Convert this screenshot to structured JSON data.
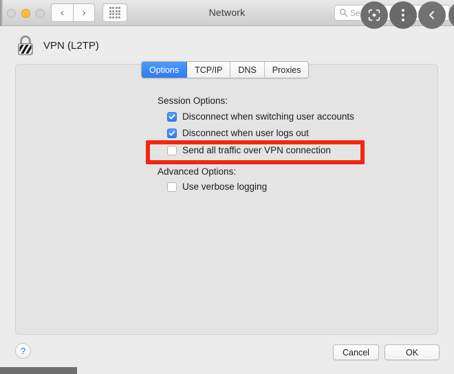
{
  "window": {
    "title": "Network"
  },
  "titlebar": {
    "traffic_lights": [
      {
        "name": "close",
        "state": "disabled"
      },
      {
        "name": "minimize",
        "state": "active"
      },
      {
        "name": "zoom",
        "state": "disabled"
      }
    ],
    "back_icon": "‹",
    "forward_icon": "›",
    "grid_icon": "grid-dots-icon",
    "search": {
      "value": "",
      "placeholder": "Search"
    }
  },
  "overlay_buttons": [
    {
      "name": "lens-icon",
      "label": ""
    },
    {
      "name": "more-vert-icon",
      "label": ""
    },
    {
      "name": "back-chevron-icon",
      "label": "‹"
    },
    {
      "name": "edge-partial",
      "label": ""
    }
  ],
  "sheet": {
    "service_name": "VPN (L2TP)",
    "lock_icon": "lock-icon"
  },
  "tabs": [
    {
      "label": "Options",
      "selected": true
    },
    {
      "label": "TCP/IP",
      "selected": false
    },
    {
      "label": "DNS",
      "selected": false
    },
    {
      "label": "Proxies",
      "selected": false
    }
  ],
  "sections": {
    "session": {
      "label": "Session Options:",
      "options": [
        {
          "label": "Disconnect when switching user accounts",
          "checked": true
        },
        {
          "label": "Disconnect when user logs out",
          "checked": true
        },
        {
          "label": "Send all traffic over VPN connection",
          "checked": false,
          "highlighted": true
        }
      ]
    },
    "advanced": {
      "label": "Advanced Options:",
      "options": [
        {
          "label": "Use verbose logging",
          "checked": false
        }
      ]
    }
  },
  "annotation": {
    "color": "#f0280f",
    "target": "Send all traffic over VPN connection"
  },
  "footer": {
    "help_label": "?",
    "cancel_label": "Cancel",
    "ok_label": "OK"
  },
  "colors": {
    "accent_blue": "#2f7ced",
    "annotation_red": "#f0280f",
    "window_bg": "#ececec",
    "panel_bg": "#e4e4e4"
  }
}
